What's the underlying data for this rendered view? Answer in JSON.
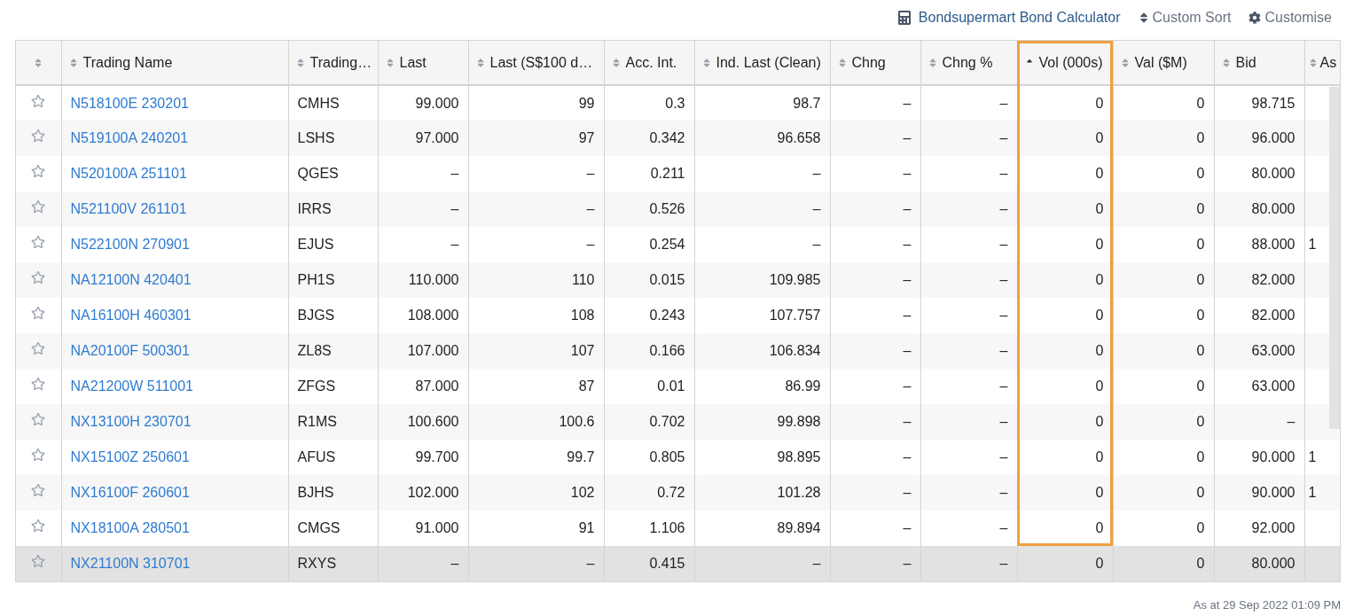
{
  "toolbar": {
    "calculator_link": "Bondsupermart Bond Calculator",
    "custom_sort": "Custom Sort",
    "customise": "Customise"
  },
  "table": {
    "star_column": {
      "sorted": false
    },
    "columns": [
      {
        "label": "Trading Name",
        "sorted": false,
        "highlighted": false
      },
      {
        "label": "Trading…",
        "sorted": false,
        "highlighted": false
      },
      {
        "label": "Last",
        "sorted": false,
        "highlighted": false
      },
      {
        "label": "Last (S$100 d…",
        "sorted": false,
        "highlighted": false
      },
      {
        "label": "Acc. Int.",
        "sorted": false,
        "highlighted": false
      },
      {
        "label": "Ind. Last (Clean)",
        "sorted": false,
        "highlighted": false
      },
      {
        "label": "Chng",
        "sorted": false,
        "highlighted": false
      },
      {
        "label": "Chng %",
        "sorted": false,
        "highlighted": false
      },
      {
        "label": "Vol (000s)",
        "sorted": true,
        "highlighted": true
      },
      {
        "label": "Val ($M)",
        "sorted": false,
        "highlighted": false
      },
      {
        "label": "Bid",
        "sorted": false,
        "highlighted": false
      },
      {
        "label": "As",
        "sorted": false,
        "highlighted": false
      }
    ],
    "rows": [
      {
        "favorite": false,
        "hovered": false,
        "cells": [
          "N518100E 230201",
          "CMHS",
          "99.000",
          "99",
          "0.3",
          "98.7",
          "–",
          "–",
          "0",
          "0",
          "98.715",
          ""
        ]
      },
      {
        "favorite": false,
        "hovered": false,
        "cells": [
          "N519100A 240201",
          "LSHS",
          "97.000",
          "97",
          "0.342",
          "96.658",
          "–",
          "–",
          "0",
          "0",
          "96.000",
          ""
        ]
      },
      {
        "favorite": false,
        "hovered": false,
        "cells": [
          "N520100A 251101",
          "QGES",
          "–",
          "–",
          "0.211",
          "–",
          "–",
          "–",
          "0",
          "0",
          "80.000",
          ""
        ]
      },
      {
        "favorite": false,
        "hovered": false,
        "cells": [
          "N521100V 261101",
          "IRRS",
          "–",
          "–",
          "0.526",
          "–",
          "–",
          "–",
          "0",
          "0",
          "80.000",
          ""
        ]
      },
      {
        "favorite": false,
        "hovered": false,
        "cells": [
          "N522100N 270901",
          "EJUS",
          "–",
          "–",
          "0.254",
          "–",
          "–",
          "–",
          "0",
          "0",
          "88.000",
          "1"
        ]
      },
      {
        "favorite": false,
        "hovered": false,
        "cells": [
          "NA12100N 420401",
          "PH1S",
          "110.000",
          "110",
          "0.015",
          "109.985",
          "–",
          "–",
          "0",
          "0",
          "82.000",
          ""
        ]
      },
      {
        "favorite": false,
        "hovered": false,
        "cells": [
          "NA16100H 460301",
          "BJGS",
          "108.000",
          "108",
          "0.243",
          "107.757",
          "–",
          "–",
          "0",
          "0",
          "82.000",
          ""
        ]
      },
      {
        "favorite": false,
        "hovered": false,
        "cells": [
          "NA20100F 500301",
          "ZL8S",
          "107.000",
          "107",
          "0.166",
          "106.834",
          "–",
          "–",
          "0",
          "0",
          "63.000",
          ""
        ]
      },
      {
        "favorite": false,
        "hovered": false,
        "cells": [
          "NA21200W 511001",
          "ZFGS",
          "87.000",
          "87",
          "0.01",
          "86.99",
          "–",
          "–",
          "0",
          "0",
          "63.000",
          ""
        ]
      },
      {
        "favorite": false,
        "hovered": false,
        "cells": [
          "NX13100H 230701",
          "R1MS",
          "100.600",
          "100.6",
          "0.702",
          "99.898",
          "–",
          "–",
          "0",
          "0",
          "–",
          ""
        ]
      },
      {
        "favorite": false,
        "hovered": false,
        "cells": [
          "NX15100Z 250601",
          "AFUS",
          "99.700",
          "99.7",
          "0.805",
          "98.895",
          "–",
          "–",
          "0",
          "0",
          "90.000",
          "1"
        ]
      },
      {
        "favorite": false,
        "hovered": false,
        "cells": [
          "NX16100F 260601",
          "BJHS",
          "102.000",
          "102",
          "0.72",
          "101.28",
          "–",
          "–",
          "0",
          "0",
          "90.000",
          "1"
        ]
      },
      {
        "favorite": false,
        "hovered": false,
        "cells": [
          "NX18100A 280501",
          "CMGS",
          "91.000",
          "91",
          "1.106",
          "89.894",
          "–",
          "–",
          "0",
          "0",
          "92.000",
          ""
        ]
      },
      {
        "favorite": false,
        "hovered": true,
        "cells": [
          "NX21100N 310701",
          "RXYS",
          "–",
          "–",
          "0.415",
          "–",
          "–",
          "–",
          "0",
          "0",
          "80.000",
          ""
        ]
      }
    ]
  },
  "timestamp": "As at 29 Sep 2022 01:09 PM"
}
